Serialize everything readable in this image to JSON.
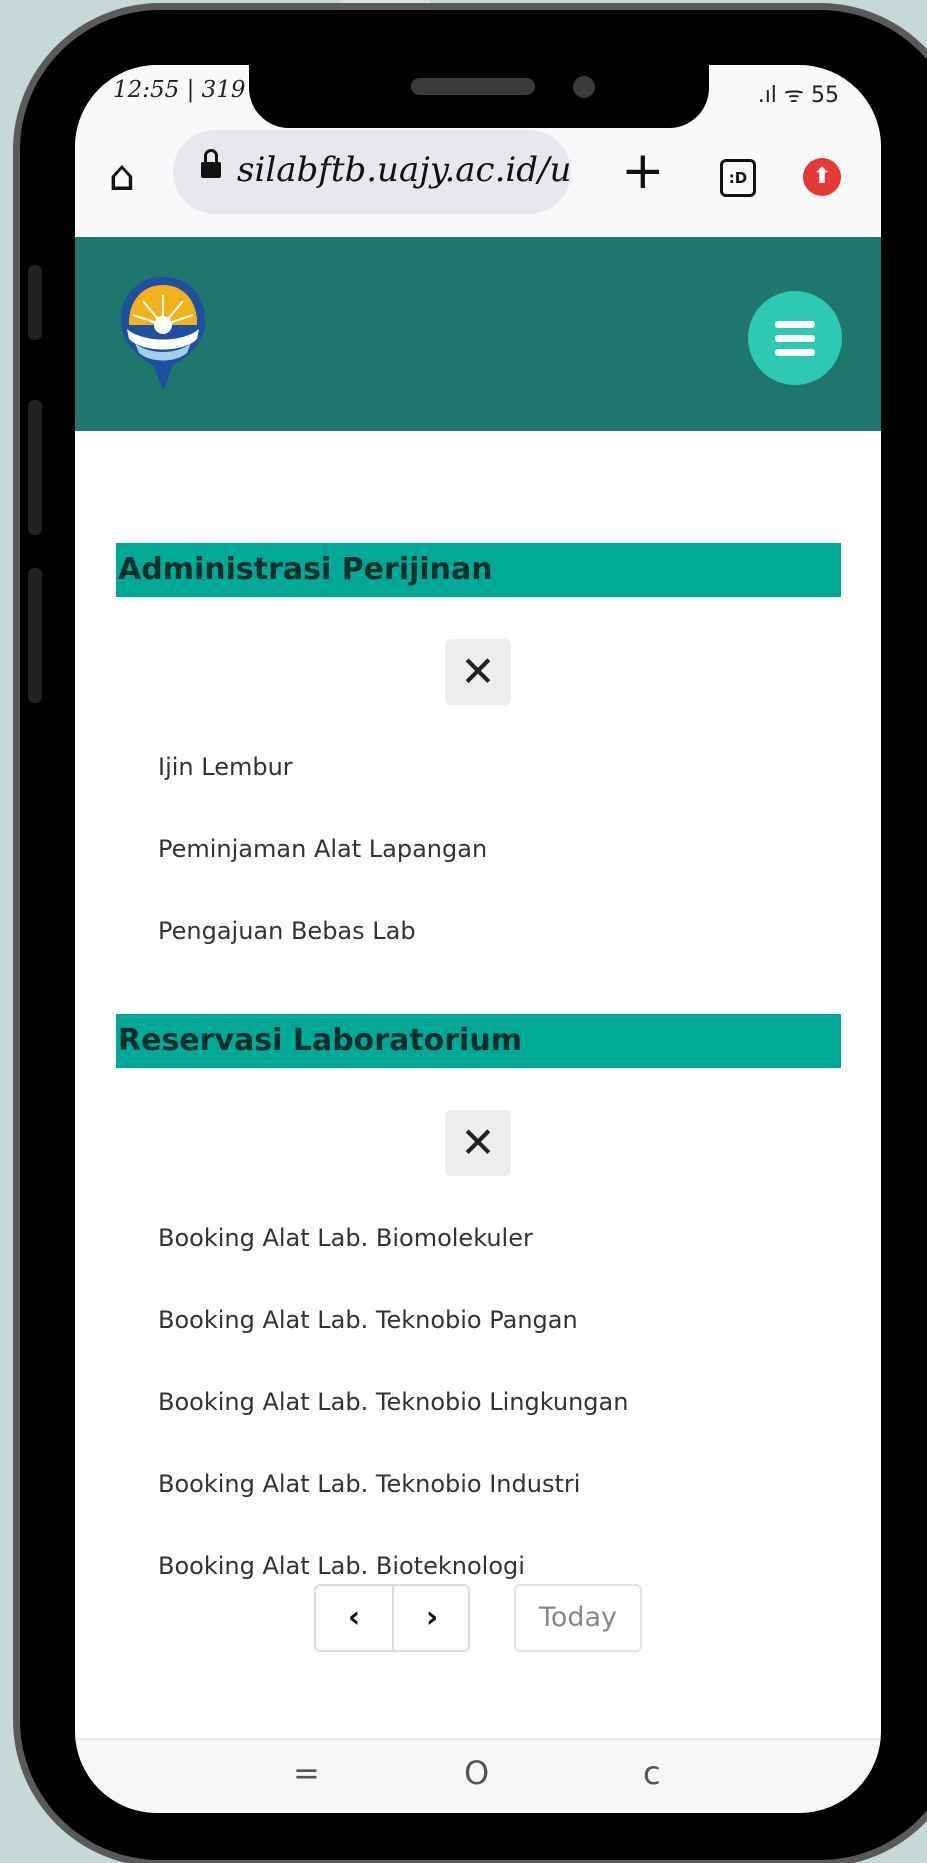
{
  "status_bar": {
    "time": "12:55 | 319",
    "icons": ".ıl ᯤ 55"
  },
  "browser": {
    "url": "silabftb.uajy.ac.id/us",
    "tabs_label": ":D",
    "new_tab": "+"
  },
  "header": {
    "menu_icon": "hamburger-icon"
  },
  "sections": [
    {
      "title": "Administrasi Perijinan",
      "close": "✕",
      "links": [
        "Ijin Lembur",
        "Peminjaman Alat Lapangan",
        "Pengajuan Bebas Lab"
      ]
    },
    {
      "title": "Reservasi Laboratorium",
      "close": "✕",
      "links": [
        "Booking Alat Lab. Biomolekuler",
        "Booking Alat Lab. Teknobio Pangan",
        "Booking Alat Lab. Teknobio Lingkungan",
        "Booking Alat Lab. Teknobio Industri",
        "Booking Alat Lab. Bioteknologi"
      ]
    }
  ],
  "calendar_controls": {
    "prev": "‹",
    "next": "›",
    "today": "Today"
  },
  "nav_bar": {
    "recents": "=",
    "home": "O",
    "back": "c"
  },
  "colors": {
    "header_bg": "#1e766c",
    "section_bg": "#00a995",
    "menu_button": "#2ec8b3"
  }
}
